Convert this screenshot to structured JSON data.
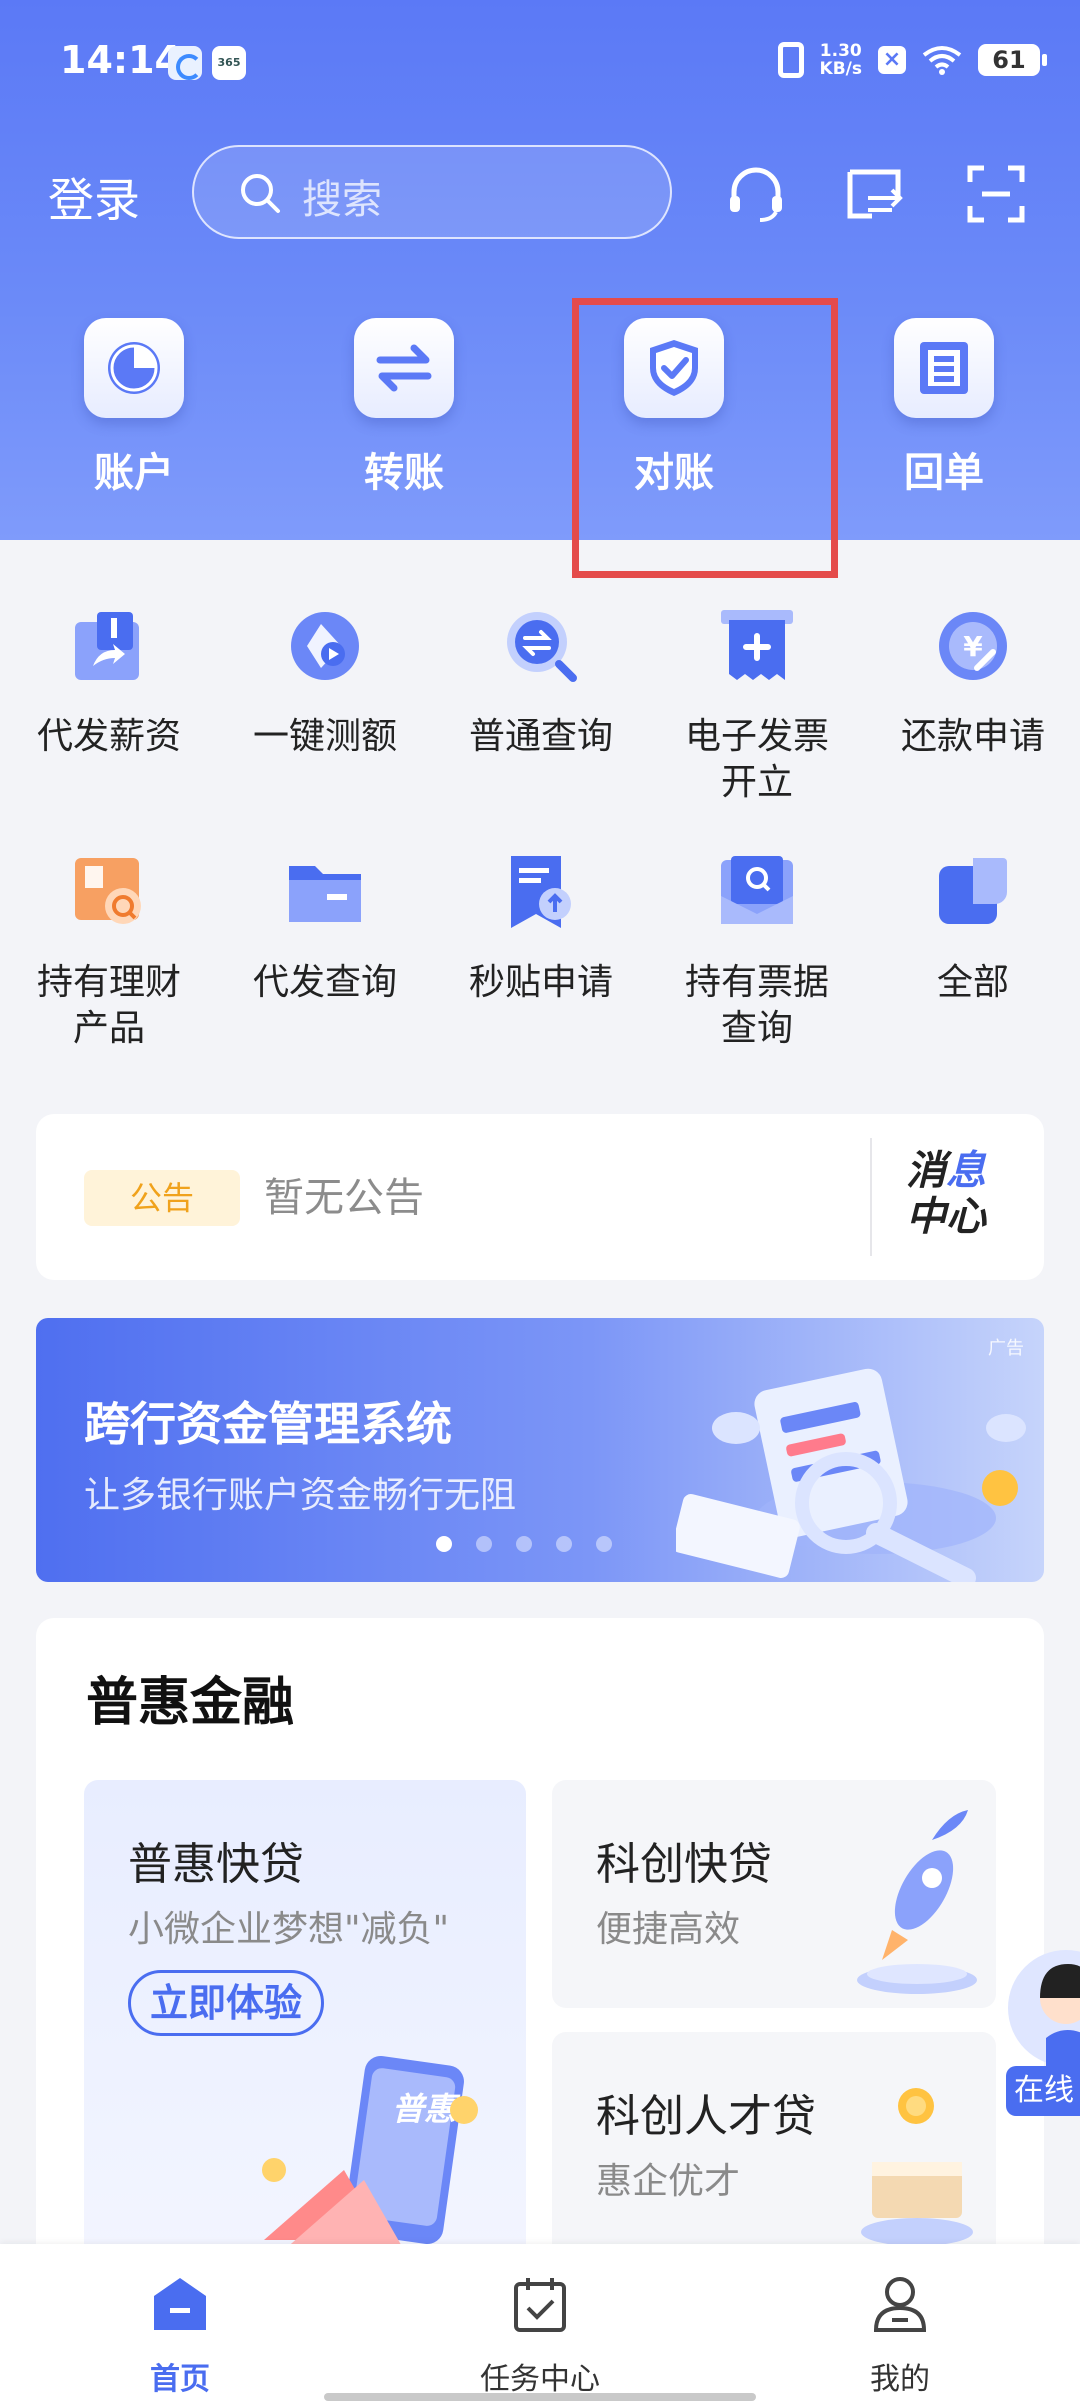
{
  "status": {
    "time": "14:14",
    "app2_label": "365",
    "net_speed_value": "1.30",
    "net_speed_unit": "KB/s",
    "battery": "61"
  },
  "topbar": {
    "login": "登录",
    "search_placeholder": "搜索",
    "icons": [
      "headset-icon",
      "screen-transfer-icon",
      "scan-icon"
    ]
  },
  "quick_actions": [
    {
      "label": "账户",
      "icon": "pie-chart-icon"
    },
    {
      "label": "转账",
      "icon": "transfer-arrows-icon"
    },
    {
      "label": "对账",
      "icon": "shield-check-icon",
      "highlighted": true
    },
    {
      "label": "回单",
      "icon": "receipt-icon"
    }
  ],
  "services": [
    {
      "label": "代发薪资",
      "icon": "payroll-icon"
    },
    {
      "label": "一键测额",
      "icon": "quota-test-icon"
    },
    {
      "label": "普通查询",
      "icon": "query-icon"
    },
    {
      "label": "电子发票开立",
      "line1": "电子发票",
      "line2": "开立",
      "icon": "e-invoice-icon"
    },
    {
      "label": "还款申请",
      "icon": "repayment-icon"
    },
    {
      "label": "持有理财产品",
      "line1": "持有理财",
      "line2": "产品",
      "icon": "wealth-product-icon"
    },
    {
      "label": "代发查询",
      "icon": "folder-query-icon"
    },
    {
      "label": "秒贴申请",
      "icon": "discount-apply-icon"
    },
    {
      "label": "持有票据查询",
      "line1": "持有票据",
      "line2": "查询",
      "icon": "bill-query-icon"
    },
    {
      "label": "全部",
      "icon": "all-services-icon"
    }
  ],
  "notice": {
    "tag": "公告",
    "text": "暂无公告",
    "message_center_1a": "消",
    "message_center_1b": "息",
    "message_center_2": "中心"
  },
  "banner": {
    "title": "跨行资金管理系统",
    "subtitle": "让多银行账户资金畅行无阻",
    "ad_tag": "广告",
    "dots": 5,
    "active_dot": 0
  },
  "finance": {
    "title": "普惠金融",
    "cards": [
      {
        "title": "普惠快贷",
        "subtitle": "小微企业梦想\"减负\"",
        "button": "立即体验",
        "art_label": "普惠"
      },
      {
        "title": "科创快贷",
        "subtitle": "便捷高效"
      },
      {
        "title": "科创人才贷",
        "subtitle": "惠企优才"
      }
    ]
  },
  "float_service": {
    "label": "在线"
  },
  "tabbar": [
    {
      "label": "首页",
      "icon": "home-icon",
      "active": true
    },
    {
      "label": "任务中心",
      "icon": "task-calendar-icon",
      "active": false
    },
    {
      "label": "我的",
      "icon": "profile-icon",
      "active": false
    }
  ],
  "colors": {
    "primary": "#4a6df0",
    "hero_top": "#5b79f6",
    "highlight": "#e44b4b",
    "notice_tag": "#f0a21c"
  }
}
